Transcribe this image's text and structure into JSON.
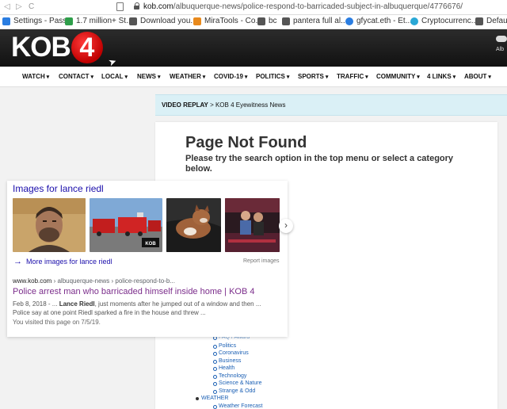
{
  "browser": {
    "back_glyph": "◁",
    "forward_glyph": "▷",
    "reload_glyph": "C",
    "url_domain": "kob.com",
    "url_path": "/albuquerque-news/police-respond-to-barricaded-subject-in-albuquerque/4776676/"
  },
  "bookmarks": [
    {
      "label": "Settings - Pass...",
      "color": "#2a7de1"
    },
    {
      "label": "1.7 million+ St...",
      "color": "#2e9e4a"
    },
    {
      "label": "Download you...",
      "color": "#555555"
    },
    {
      "label": "MiraTools - Co...",
      "color": "#e8891c"
    },
    {
      "label": "bc",
      "color": "#555555"
    },
    {
      "label": "pantera full al...",
      "color": "#555555"
    },
    {
      "label": "gfycat.eth - Et...",
      "color": "#2a7de1"
    },
    {
      "label": "Cryptocurrenc...",
      "color": "#2aa8d6"
    },
    {
      "label": "Default",
      "color": "#555555"
    }
  ],
  "site": {
    "logo_text": "KOB",
    "logo_number": "4",
    "weather_label": "Alb",
    "accent_color": "#c00000"
  },
  "nav": [
    "WATCH",
    "CONTACT",
    "LOCAL",
    "NEWS",
    "WEATHER",
    "COVID-19",
    "POLITICS",
    "SPORTS",
    "TRAFFIC",
    "COMMUNITY",
    "4 LINKS",
    "ABOUT"
  ],
  "replay": {
    "label": "VIDEO REPLAY",
    "separator": " > ",
    "title": "KOB 4 Eyewitness News"
  },
  "notfound": {
    "title": "Page Not Found",
    "subtitle": "Please try the search option in the top menu or select a category below."
  },
  "sitemap": {
    "partial_top": "FAQ / Award",
    "items": [
      "Politics",
      "Coronavirus",
      "Business",
      "Health",
      "Technology",
      "Science & Nature",
      "Strange & Odd"
    ],
    "weather": "WEATHER",
    "weather_first": "Weather Forecast"
  },
  "search_overlay": {
    "images_title": "Images for lance riedl",
    "more_images": "More images for lance riedl",
    "report_images": "Report images",
    "next_glyph": "›",
    "more_glyph": "→",
    "result": {
      "cite_domain": "www.kob.com",
      "cite_path": " › albuquerque-news › police-respond-to-b...",
      "title": "Police arrest man who barricaded himself inside home | KOB 4",
      "snippet_date": "Feb 8, 2018 - ... ",
      "snippet_bold": "Lance Riedl",
      "snippet_rest": ", just moments after he jumped out of a window and then ... Police say at one point Riedl sparked a fire in the house and threw ...",
      "visited": "You visited this page on 7/5/19."
    },
    "thumbnails": [
      "mugshot",
      "fire-trucks-scene",
      "dog-on-couch",
      "couple-photo"
    ],
    "thumb_badge": "KOB"
  }
}
